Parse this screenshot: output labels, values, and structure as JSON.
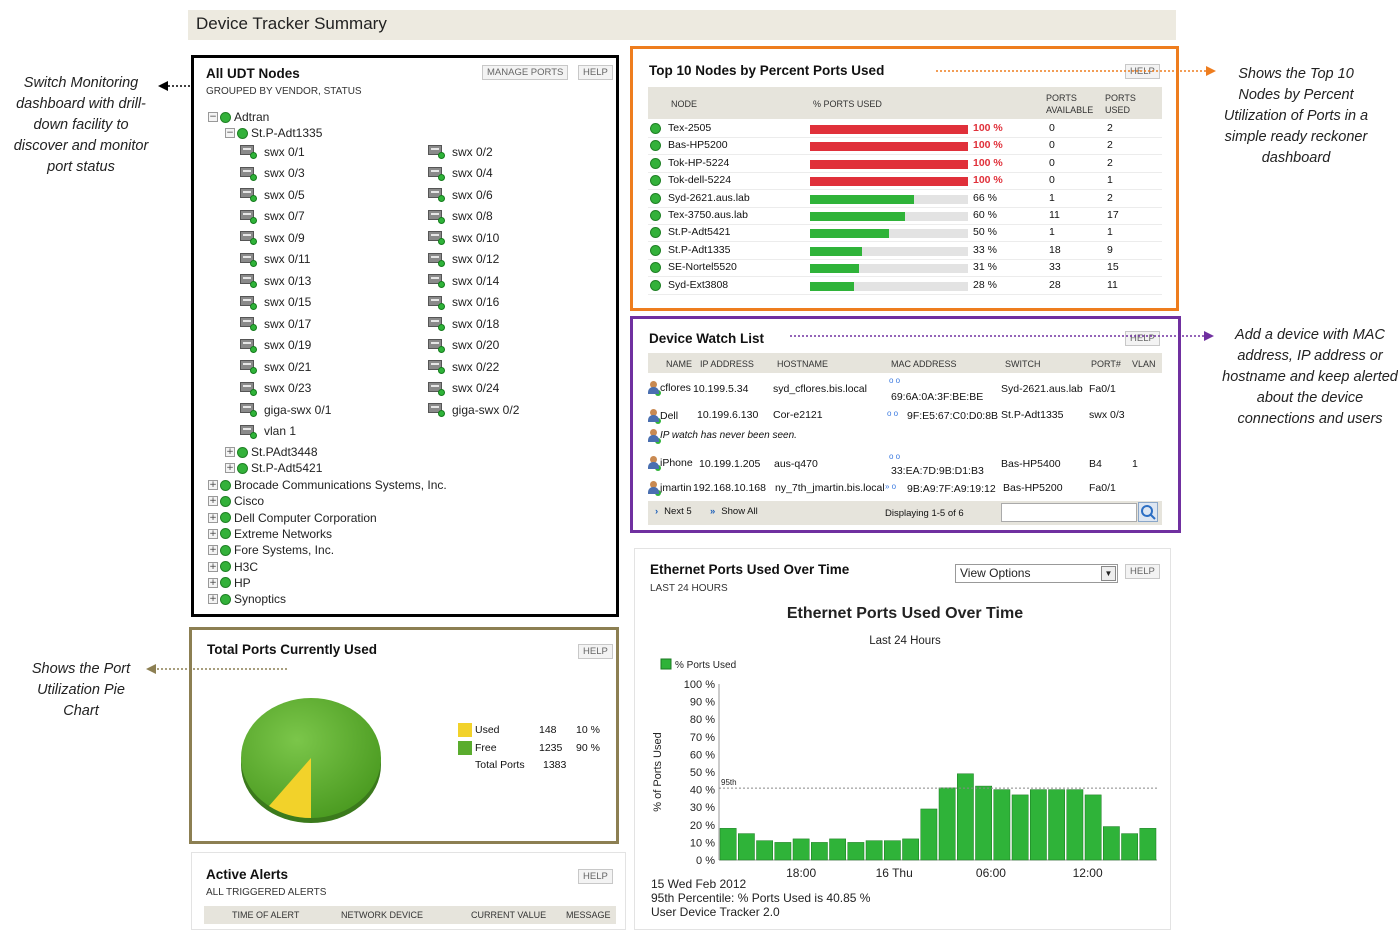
{
  "page": {
    "title": "Device Tracker Summary"
  },
  "udt_nodes": {
    "title": "All UDT Nodes",
    "subtitle": "GROUPED BY VENDOR, STATUS",
    "manage_ports": "MANAGE PORTS",
    "help": "HELP",
    "root": "Adtran",
    "node": "St.P-Adt1335",
    "ports": [
      "swx 0/1",
      "swx 0/2",
      "swx 0/3",
      "swx 0/4",
      "swx 0/5",
      "swx 0/6",
      "swx 0/7",
      "swx 0/8",
      "swx 0/9",
      "swx 0/10",
      "swx 0/11",
      "swx 0/12",
      "swx 0/13",
      "swx 0/14",
      "swx 0/15",
      "swx 0/16",
      "swx 0/17",
      "swx 0/18",
      "swx 0/19",
      "swx 0/20",
      "swx 0/21",
      "swx 0/22",
      "swx 0/23",
      "swx 0/24",
      "giga-swx 0/1",
      "giga-swx 0/2",
      "vlan 1"
    ],
    "sub_nodes": [
      "St.PAdt3448",
      "St.P-Adt5421"
    ],
    "vendors": [
      "Brocade Communications Systems, Inc.",
      "Cisco",
      "Dell Computer Corporation",
      "Extreme Networks",
      "Fore Systems, Inc.",
      "H3C",
      "HP",
      "Synoptics"
    ]
  },
  "top10": {
    "title": "Top 10 Nodes by Percent Ports Used",
    "help": "HELP",
    "col_node": "NODE",
    "col_pct": "% PORTS USED",
    "col_avail": "PORTS AVAILABLE",
    "col_used": "PORTS USED",
    "rows": [
      {
        "node": "Tex-2505",
        "pct": 100,
        "pct_label": "100 %",
        "avail": "0",
        "used": "2"
      },
      {
        "node": "Bas-HP5200",
        "pct": 100,
        "pct_label": "100 %",
        "avail": "0",
        "used": "2"
      },
      {
        "node": "Tok-HP-5224",
        "pct": 100,
        "pct_label": "100 %",
        "avail": "0",
        "used": "2"
      },
      {
        "node": "Tok-dell-5224",
        "pct": 100,
        "pct_label": "100 %",
        "avail": "0",
        "used": "1"
      },
      {
        "node": "Syd-2621.aus.lab",
        "pct": 66,
        "pct_label": "66 %",
        "avail": "1",
        "used": "2"
      },
      {
        "node": "Tex-3750.aus.lab",
        "pct": 60,
        "pct_label": "60 %",
        "avail": "11",
        "used": "17"
      },
      {
        "node": "St.P-Adt5421",
        "pct": 50,
        "pct_label": "50 %",
        "avail": "1",
        "used": "1"
      },
      {
        "node": "St.P-Adt1335",
        "pct": 33,
        "pct_label": "33 %",
        "avail": "18",
        "used": "9"
      },
      {
        "node": "SE-Nortel5520",
        "pct": 31,
        "pct_label": "31 %",
        "avail": "33",
        "used": "15"
      },
      {
        "node": "Syd-Ext3808",
        "pct": 28,
        "pct_label": "28 %",
        "avail": "28",
        "used": "11"
      }
    ],
    "colors": {
      "full": "#e0303a",
      "partial": "#2fb339"
    }
  },
  "watch": {
    "title": "Device Watch List",
    "help": "HELP",
    "headers": [
      "NAME",
      "IP ADDRESS",
      "HOSTNAME",
      "MAC ADDRESS",
      "SWITCH",
      "PORT#",
      "VLAN"
    ],
    "rows": [
      {
        "name": "cflores",
        "ip": "10.199.5.34",
        "host": "syd_cflores.bis.local",
        "mac": "69:6A:0A:3F:BE:BE",
        "switch": "Syd-2621.aus.lab",
        "port": "Fa0/1",
        "vlan": ""
      },
      {
        "name": "Dell",
        "ip": "10.199.6.130",
        "host": "Cor-e2121",
        "mac": "9F:E5:67:C0:D0:8B",
        "switch": "St.P-Adt1335",
        "port": "swx 0/3",
        "vlan": ""
      },
      {
        "name": "iPhone",
        "ip": "10.199.1.205",
        "host": "aus-q470",
        "mac": "33:EA:7D:9B:D1:B3",
        "switch": "Bas-HP5400",
        "port": "B4",
        "vlan": "1"
      },
      {
        "name": "jmartin",
        "ip": "192.168.10.168",
        "host": "ny_7th_jmartin.bis.local",
        "mac": "9B:A9:7F:A9:19:12",
        "switch": "Bas-HP5200",
        "port": "Fa0/1",
        "vlan": ""
      }
    ],
    "never_seen": "IP watch has never been seen.",
    "next": "Next 5",
    "show_all": "Show All",
    "displaying": "Displaying 1-5 of 6"
  },
  "ethernet": {
    "title": "Ethernet Ports Used Over Time",
    "subtitle": "LAST 24 HOURS",
    "view_options": "View Options",
    "help": "HELP",
    "footer_date": "15 Wed Feb 2012",
    "footer_pct": "95th Percentile: % Ports Used is 40.85 %",
    "footer_product": "User Device Tracker 2.0"
  },
  "total_ports": {
    "title": "Total Ports Currently Used",
    "help": "HELP",
    "legend": [
      {
        "label": "Used",
        "count": "148",
        "pct": "10 %",
        "color": "#f2d22a"
      },
      {
        "label": "Free",
        "count": "1235",
        "pct": "90 %",
        "color": "#5aac2e"
      }
    ],
    "total_label": "Total Ports",
    "total_value": "1383"
  },
  "alerts": {
    "title": "Active Alerts",
    "subtitle": "ALL TRIGGERED ALERTS",
    "help": "HELP",
    "headers": [
      "TIME OF ALERT",
      "NETWORK DEVICE",
      "CURRENT VALUE",
      "MESSAGE"
    ]
  },
  "annotations": {
    "switch_monitoring": "Switch Monitoring dashboard with drill-down facility to discover and monitor port status",
    "top10_note": "Shows the Top 10 Nodes by Percent Utilization of Ports in a simple ready reckoner dashboard",
    "watch_note": "Add a device with MAC address, IP address or hostname and keep alerted about the device connections and users",
    "pie_note": "Shows the Port Utilization Pie Chart"
  },
  "chart_data": {
    "type": "bar",
    "title": "Ethernet Ports Used Over Time",
    "subtitle": "Last 24 Hours",
    "ylabel": "% of Ports Used",
    "series": [
      {
        "name": "% Ports Used",
        "values": [
          18,
          15,
          11,
          10,
          12,
          10,
          12,
          10,
          11,
          11,
          12,
          29,
          41,
          49,
          42,
          40,
          37,
          40,
          40,
          40,
          37,
          19,
          15,
          18
        ]
      }
    ],
    "x_ticks": [
      "18:00",
      "16 Thu",
      "06:00",
      "12:00"
    ],
    "y_ticks": [
      "0 %",
      "10 %",
      "20 %",
      "30 %",
      "40 %",
      "50 %",
      "60 %",
      "70 %",
      "80 %",
      "90 %",
      "100 %"
    ],
    "ylim": [
      0,
      100
    ],
    "percentile_label": "95th",
    "percentile_value": 40.85,
    "bar_color": "#2fb339"
  }
}
